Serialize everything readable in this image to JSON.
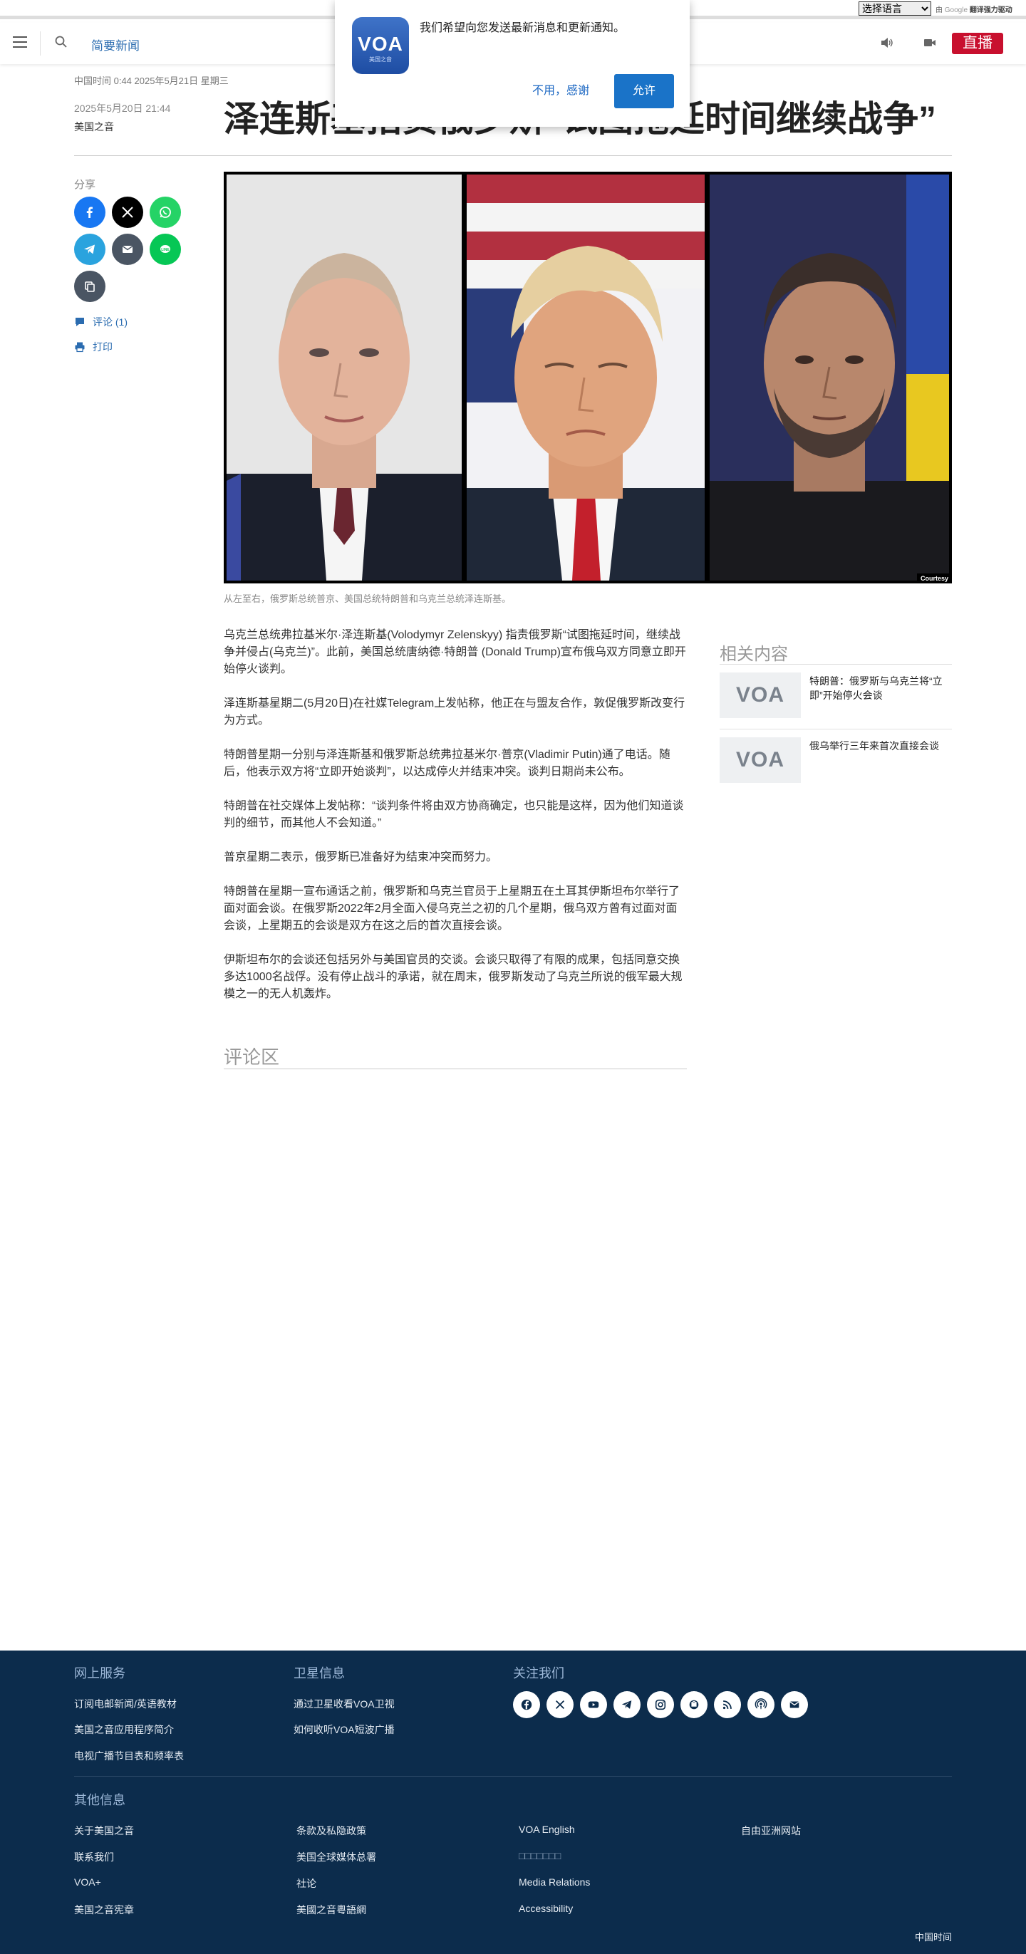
{
  "translate": {
    "select_label": "选择语言",
    "powered_prefix": "由",
    "powered_brand": "Google",
    "powered_suffix": "翻译强力驱动"
  },
  "header": {
    "nav_link": "简要新闻",
    "live_label": "直播"
  },
  "notification": {
    "logo_mark": "VOA",
    "logo_sub": "美国之音",
    "message": "我们希望向您发送最新消息和更新通知。",
    "deny_label": "不用，感谢",
    "allow_label": "允许"
  },
  "article": {
    "timebar": "中国时间 0:44 2025年5月21日 星期三",
    "date": "2025年5月20日 21:44",
    "author": "美国之音",
    "headline": "泽连斯基指责俄罗斯“试图拖延时间继续战争”",
    "image_courtesy": "Courtesy",
    "caption": "从左至右，俄罗斯总统普京、美国总统特朗普和乌克兰总统泽连斯基。",
    "paragraphs": [
      "乌克兰总统弗拉基米尔·泽连斯基(Volodymyr Zelenskyy) 指责俄罗斯“试图拖延时间，继续战争并侵占(乌克兰)”。此前，美国总统唐纳德·特朗普 (Donald Trump)宣布俄乌双方同意立即开始停火谈判。",
      "泽连斯基星期二(5月20日)在社媒Telegram上发帖称，他正在与盟友合作，敦促俄罗斯改变行为方式。",
      "特朗普星期一分别与泽连斯基和俄罗斯总统弗拉基米尔·普京(Vladimir Putin)通了电话。随后，他表示双方将“立即开始谈判”，以达成停火并结束冲突。谈判日期尚未公布。",
      "特朗普在社交媒体上发帖称：“谈判条件将由双方协商确定，也只能是这样，因为他们知道谈判的细节，而其他人不会知道。”",
      "普京星期二表示，俄罗斯已准备好为结束冲突而努力。",
      "特朗普在星期一宣布通话之前，俄罗斯和乌克兰官员于上星期五在土耳其伊斯坦布尔举行了面对面会谈。在俄罗斯2022年2月全面入侵乌克兰之初的几个星期，俄乌双方曾有过面对面会谈，上星期五的会谈是双方在这之后的首次直接会谈。",
      "伊斯坦布尔的会谈还包括另外与美国官员的交谈。会谈只取得了有限的成果，包括同意交换多达1000名战俘。没有停止战斗的承诺，就在周末，俄罗斯发动了乌克兰所说的俄军最大规模之一的无人机轰炸。"
    ],
    "comments_heading": "评论区"
  },
  "share": {
    "label": "分享",
    "comments_link": "评论 (1)",
    "print_link": "打印",
    "colors": {
      "facebook": "#1877f2",
      "x": "#000000",
      "whatsapp": "#25d366",
      "telegram": "#2aa3de",
      "email": "#4a5563",
      "line": "#06c755",
      "copy": "#4a5563"
    }
  },
  "related": {
    "title": "相关内容",
    "thumb_mark": "VOA",
    "items": [
      {
        "title": "特朗普：俄罗斯与乌克兰将“立即”开始停火会谈"
      },
      {
        "title": "俄乌举行三年来首次直接会谈"
      }
    ]
  },
  "footer": {
    "col1": {
      "heading": "网上服务",
      "links": [
        "订阅电邮新闻/英语教材",
        "美国之音应用程序简介",
        "电视广播节目表和频率表"
      ]
    },
    "col2": {
      "heading": "卫星信息",
      "links": [
        "通过卫星收看VOA卫视",
        "如何收听VOA短波广播"
      ]
    },
    "col3": {
      "heading": "关注我们"
    },
    "other": {
      "heading": "其他信息",
      "col_a": [
        "关于美国之音",
        "联系我们",
        "VOA+",
        "美国之音宪章"
      ],
      "col_b": [
        "条款及私隐政策",
        "美国全球媒体总署",
        "社论",
        "美國之音粵語網"
      ],
      "col_c": [
        "VOA English",
        "□□□□□□□",
        "Media Relations",
        "Accessibility"
      ],
      "col_d": [
        "自由亚洲网站"
      ]
    },
    "time_label": "中国时间",
    "bg_color": "#0c2c4c"
  },
  "colors": {
    "live_red": "#c8102e",
    "link_blue": "#2b6cb0",
    "allow_blue": "#1a73c8"
  }
}
